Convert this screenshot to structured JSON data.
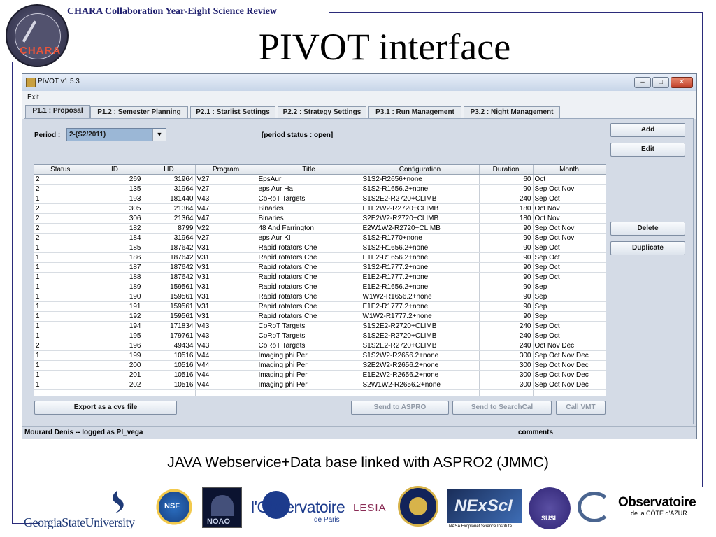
{
  "slide": {
    "header": "CHARA Collaboration Year-Eight Science Review",
    "title": "PIVOT interface",
    "caption": "JAVA Webservice+Data base linked with ASPRO2 (JMMC)",
    "colors": {
      "frame": "#2b2b7a",
      "header_text": "#1f1f6e",
      "title_text": "#000000"
    }
  },
  "logos": {
    "chara": "CHARA",
    "gsu": "GeorgiaStateUniversity",
    "nsf": "NSF",
    "noao": "NOAO",
    "obs_paris_prefix": "l'",
    "obs_paris_main": "Observatoire",
    "obs_paris_sub": "de Paris",
    "lesia": "LESIA",
    "nexsci": "NExScI",
    "nexsci_sub": "NASA Exoplanet Science Institute",
    "susi": "SUSI",
    "oca_main": "Observatoire",
    "oca_sub": "de la CÔTE d'AZUR"
  },
  "window": {
    "title": "PIVOT v1.5.3",
    "menu": {
      "exit": "Exit"
    },
    "controls": {
      "minimize": "–",
      "maximize": "□",
      "close": "✕"
    },
    "tabs": [
      {
        "label": "P1.1 : Proposal",
        "active": true
      },
      {
        "label": "P1.2 : Semester Planning",
        "active": false
      },
      {
        "label": "P2.1 : Starlist Settings",
        "active": false
      },
      {
        "label": "P2.2 : Strategy Settings",
        "active": false
      },
      {
        "label": "P3.1 : Run Management",
        "active": false
      },
      {
        "label": "P3.2 : Night Management",
        "active": false
      }
    ],
    "period": {
      "label": "Period :",
      "value": "2-(S2/2011)",
      "status": "[period status : open]"
    },
    "table": {
      "columns": [
        "Status",
        "ID",
        "HD",
        "Program",
        "Title",
        "Configuration",
        "Duration",
        "Month"
      ],
      "rows": [
        [
          "2",
          "269",
          "31964",
          "V27",
          "EpsAur",
          "S1S2-R2656+none",
          "60",
          "Oct"
        ],
        [
          "2",
          "135",
          "31964",
          "V27",
          "eps Aur Ha",
          "S1S2-R1656.2+none",
          "90",
          "Sep Oct Nov"
        ],
        [
          "1",
          "193",
          "181440",
          "V43",
          "CoRoT Targets",
          "S1S2E2-R2720+CLIMB",
          "240",
          "Sep Oct"
        ],
        [
          "2",
          "305",
          "21364",
          "V47",
          "Binaries",
          "E1E2W2-R2720+CLIMB",
          "180",
          "Oct Nov"
        ],
        [
          "2",
          "306",
          "21364",
          "V47",
          "Binaries",
          "S2E2W2-R2720+CLIMB",
          "180",
          "Oct Nov"
        ],
        [
          "2",
          "182",
          "8799",
          "V22",
          "48 And Farrington",
          "E2W1W2-R2720+CLIMB",
          "90",
          "Sep Oct Nov"
        ],
        [
          "2",
          "184",
          "31964",
          "V27",
          "eps Aur KI",
          "S1S2-R1770+none",
          "90",
          "Sep Oct Nov"
        ],
        [
          "1",
          "185",
          "187642",
          "V31",
          "Rapid rotators Che",
          "S1S2-R1656.2+none",
          "90",
          "Sep Oct"
        ],
        [
          "1",
          "186",
          "187642",
          "V31",
          "Rapid rotators Che",
          "E1E2-R1656.2+none",
          "90",
          "Sep Oct"
        ],
        [
          "1",
          "187",
          "187642",
          "V31",
          "Rapid rotators Che",
          "S1S2-R1777.2+none",
          "90",
          "Sep Oct"
        ],
        [
          "1",
          "188",
          "187642",
          "V31",
          "Rapid rotators Che",
          "E1E2-R1777.2+none",
          "90",
          "Sep Oct"
        ],
        [
          "1",
          "189",
          "159561",
          "V31",
          "Rapid rotators Che",
          "E1E2-R1656.2+none",
          "90",
          "Sep"
        ],
        [
          "1",
          "190",
          "159561",
          "V31",
          "Rapid rotators Che",
          "W1W2-R1656.2+none",
          "90",
          "Sep"
        ],
        [
          "1",
          "191",
          "159561",
          "V31",
          "Rapid rotators Che",
          "E1E2-R1777.2+none",
          "90",
          "Sep"
        ],
        [
          "1",
          "192",
          "159561",
          "V31",
          "Rapid rotators Che",
          "W1W2-R1777.2+none",
          "90",
          "Sep"
        ],
        [
          "1",
          "194",
          "171834",
          "V43",
          "CoRoT Targets",
          "S1S2E2-R2720+CLIMB",
          "240",
          "Sep Oct"
        ],
        [
          "1",
          "195",
          "179761",
          "V43",
          "CoRoT Targets",
          "S1S2E2-R2720+CLIMB",
          "240",
          "Sep Oct"
        ],
        [
          "2",
          "196",
          "49434",
          "V43",
          "CoRoT Targets",
          "S1S2E2-R2720+CLIMB",
          "240",
          "Oct Nov Dec"
        ],
        [
          "1",
          "199",
          "10516",
          "V44",
          "Imaging phi Per",
          "S1S2W2-R2656.2+none",
          "300",
          "Sep Oct Nov Dec"
        ],
        [
          "1",
          "200",
          "10516",
          "V44",
          "Imaging phi Per",
          "S2E2W2-R2656.2+none",
          "300",
          "Sep Oct Nov Dec"
        ],
        [
          "1",
          "201",
          "10516",
          "V44",
          "Imaging phi Per",
          "E1E2W2-R2656.2+none",
          "300",
          "Sep Oct Nov Dec"
        ],
        [
          "1",
          "202",
          "10516",
          "V44",
          "Imaging phi Per",
          "S2W1W2-R2656.2+none",
          "300",
          "Sep Oct Nov Dec"
        ]
      ]
    },
    "side_buttons": {
      "add": "Add",
      "edit": "Edit",
      "delete": "Delete",
      "duplicate": "Duplicate"
    },
    "bottom_buttons": {
      "export": "Export as a cvs file",
      "send_aspro": "Send to ASPRO",
      "send_searchcal": "Send to SearchCal",
      "call_vmt": "Call VMT"
    },
    "status": {
      "user": "Mourard Denis -- logged as PI_vega",
      "comments": "comments"
    },
    "colors": {
      "window_bg": "#d4dbe6",
      "titlebar": "#c7d5e8",
      "selected_combo": "#9bb7d6"
    }
  }
}
